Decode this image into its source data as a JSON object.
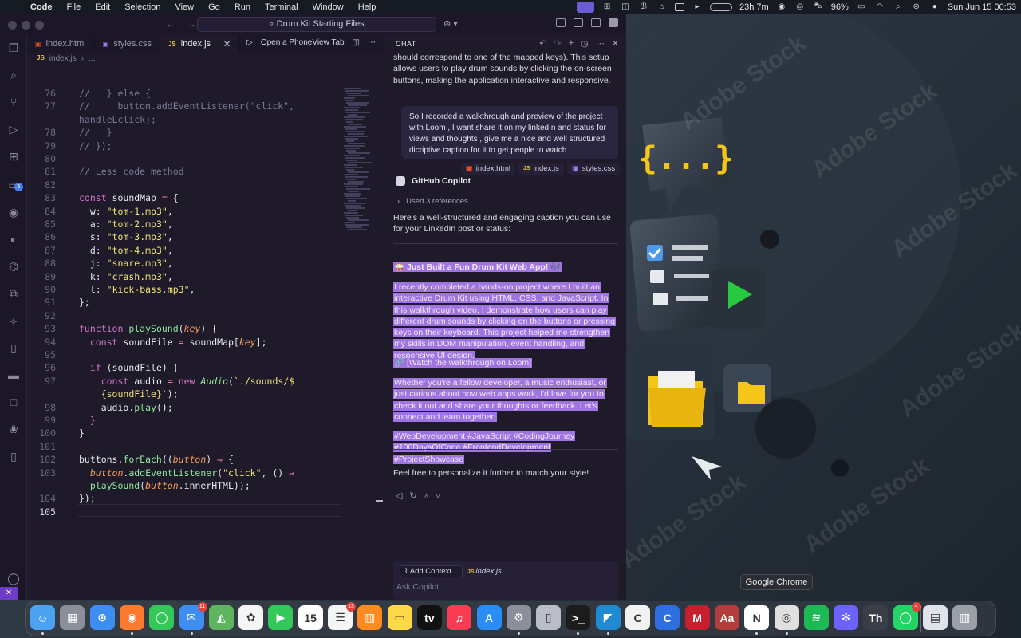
{
  "menubar": {
    "app_name": "Code",
    "items": [
      "File",
      "Edit",
      "Selection",
      "View",
      "Go",
      "Run",
      "Terminal",
      "Window",
      "Help"
    ],
    "timer": "23h 7m",
    "battery": "96%",
    "datetime": "Sun Jun 15  00:53"
  },
  "titlebar": {
    "command_center": "Drum Kit Starting Files"
  },
  "activity_badge": "6",
  "editor": {
    "tabs": [
      {
        "label": "index.html",
        "icon": "html-file-icon"
      },
      {
        "label": "styles.css",
        "icon": "css-file-icon"
      },
      {
        "label": "index.js",
        "icon": "js-file-icon"
      }
    ],
    "tab_action": "Open a PhoneView Tab",
    "breadcrumb": {
      "file": "index.js",
      "rest": "..."
    },
    "current_line": "105"
  },
  "code_lines": [
    {
      "n": "76",
      "html": "<span class=\"tok-com\">//   } else {</span>"
    },
    {
      "n": "77",
      "html": "<span class=\"tok-com\">//     button.addEventListener(\"click\",</span>"
    },
    {
      "n": "",
      "html": "<span class=\"tok-com\">handleLclick);</span>"
    },
    {
      "n": "78",
      "html": "<span class=\"tok-com\">//   }</span>"
    },
    {
      "n": "79",
      "html": "<span class=\"tok-com\">// });</span>"
    },
    {
      "n": "80",
      "html": ""
    },
    {
      "n": "81",
      "html": "<span class=\"tok-com\">// Less code method</span>"
    },
    {
      "n": "82",
      "html": ""
    },
    {
      "n": "83",
      "html": "<span class=\"tok-kw\">const</span> <span class=\"tok-var\">soundMap</span> <span class=\"tok-op\">=</span> <span class=\"tok-var\">{</span>"
    },
    {
      "n": "84",
      "html": "  <span class=\"tok-var\">w:</span> <span class=\"tok-str\">\"tom-1.mp3\"</span><span class=\"tok-var\">,</span>"
    },
    {
      "n": "85",
      "html": "  <span class=\"tok-var\">a:</span> <span class=\"tok-str\">\"tom-2.mp3\"</span><span class=\"tok-var\">,</span>"
    },
    {
      "n": "86",
      "html": "  <span class=\"tok-var\">s:</span> <span class=\"tok-str\">\"tom-3.mp3\"</span><span class=\"tok-var\">,</span>"
    },
    {
      "n": "87",
      "html": "  <span class=\"tok-var\">d:</span> <span class=\"tok-str\">\"tom-4.mp3\"</span><span class=\"tok-var\">,</span>"
    },
    {
      "n": "88",
      "html": "  <span class=\"tok-var\">j:</span> <span class=\"tok-str\">\"snare.mp3\"</span><span class=\"tok-var\">,</span>"
    },
    {
      "n": "89",
      "html": "  <span class=\"tok-var\">k:</span> <span class=\"tok-str\">\"crash.mp3\"</span><span class=\"tok-var\">,</span>"
    },
    {
      "n": "90",
      "html": "  <span class=\"tok-var\">l:</span> <span class=\"tok-str\">\"kick-bass.mp3\"</span><span class=\"tok-var\">,</span>"
    },
    {
      "n": "91",
      "html": "<span class=\"tok-var\">};</span>"
    },
    {
      "n": "92",
      "html": ""
    },
    {
      "n": "93",
      "html": "<span class=\"tok-kw\">function</span> <span class=\"tok-fn\">playSound</span><span class=\"tok-var\">(</span><span class=\"tok-param\">key</span><span class=\"tok-var\">) {</span>"
    },
    {
      "n": "94",
      "html": "  <span class=\"tok-kw\">const</span> <span class=\"tok-var\">soundFile</span> <span class=\"tok-op\">=</span> <span class=\"tok-var\">soundMap[</span><span class=\"tok-param\">key</span><span class=\"tok-var\">];</span>"
    },
    {
      "n": "95",
      "html": ""
    },
    {
      "n": "96",
      "html": "  <span class=\"tok-kw\">if</span> <span class=\"tok-var\">(soundFile) {</span>"
    },
    {
      "n": "97",
      "html": "    <span class=\"tok-kw\">const</span> <span class=\"tok-var\">audio</span> <span class=\"tok-op\">=</span> <span class=\"tok-kw\">new</span> <span class=\"tok-cls\">Audio</span><span class=\"tok-var\">(</span><span class=\"tok-str\">`./sounds/$</span>"
    },
    {
      "n": "",
      "html": "    <span class=\"tok-str\">{soundFile}`</span><span class=\"tok-var\">);</span>"
    },
    {
      "n": "98",
      "html": "    <span class=\"tok-var\">audio.</span><span class=\"tok-fn\">play</span><span class=\"tok-var\">();</span>"
    },
    {
      "n": "99",
      "html": "  <span class=\"tok-kw\">}</span>"
    },
    {
      "n": "100",
      "html": "<span class=\"tok-var\">}</span>"
    },
    {
      "n": "101",
      "html": ""
    },
    {
      "n": "102",
      "html": "<span class=\"tok-var\">buttons.</span><span class=\"tok-fn\">forEach</span><span class=\"tok-var\">((</span><span class=\"tok-param\">button</span><span class=\"tok-var\">)</span> <span class=\"tok-op\">⇒</span> <span class=\"tok-var\">{</span>"
    },
    {
      "n": "103",
      "html": "  <span class=\"tok-param\">button</span><span class=\"tok-var\">.</span><span class=\"tok-fn\">addEventListener</span><span class=\"tok-var\">(</span><span class=\"tok-str\">\"click\"</span><span class=\"tok-var\">, ()</span> <span class=\"tok-op\">⇒</span>"
    },
    {
      "n": "",
      "html": "  <span class=\"tok-fn\">playSound</span><span class=\"tok-var\">(</span><span class=\"tok-param\">button</span><span class=\"tok-var\">.innerHTML));</span>"
    },
    {
      "n": "104",
      "html": "<span class=\"tok-var\">});</span>"
    },
    {
      "n": "105",
      "html": ""
    }
  ],
  "chat": {
    "title": "CHAT",
    "intro_text": "should correspond to one of the mapped keys). This setup allows users to play drum sounds by clicking the on-screen buttons, making the application interactive and responsive.",
    "user_message": "So I recorded a walkthrough and preview of the project with Loom , I want share it on my linkedIn and status for views and thoughts , give me a nice and well structured dicriptive caption for it to get people to watch",
    "references": [
      "index.html",
      "index.js",
      "styles.css"
    ],
    "assistant_name": "GitHub Copilot",
    "used_references": "Used 3 references",
    "reply_intro": "Here's a well-structured and engaging caption you can use for your LinkedIn post or status:",
    "caption_title": "🥁 Just Built a Fun Drum Kit Web App! 🎶",
    "caption_body": "I recently completed a hands-on project where I built an interactive Drum Kit using HTML, CSS, and JavaScript. In this walkthrough video, I demonstrate how users can play different drum sounds by clicking on the buttons or pressing keys on their keyboard. This project helped me strengthen my skills in DOM manipulation, event handling, and responsive UI design.",
    "caption_link": "🔗 [Watch the walkthrough on Loom]",
    "caption_cta": "Whether you're a fellow developer, a music enthusiast, or just curious about how web apps work, I'd love for you to check it out and share your thoughts or feedback. Let's connect and learn together!",
    "hashtags_1": "#WebDevelopment #JavaScript #CodingJourney",
    "hashtags_2": "#100DaysOfCode #FrontendDevelopment #ProjectShowcase",
    "reply_outro": "Feel free to personalize it further to match your style!",
    "add_context": "Add Context...",
    "context_file": "index.js",
    "input_placeholder": "Ask Copilot"
  },
  "desktop": {
    "watermark": "Adobe Stock"
  },
  "dock": {
    "tooltip": "Google Chrome",
    "apps": [
      {
        "name": "Finder",
        "icon": "finder-icon",
        "color": "#4aa2f0",
        "glyph": "☺",
        "dot": true
      },
      {
        "name": "Launchpad",
        "icon": "launchpad-icon",
        "color": "#8b8f99",
        "glyph": "▦",
        "dot": false
      },
      {
        "name": "Safari",
        "icon": "safari-icon",
        "color": "#3d8ef0",
        "glyph": "⊙",
        "dot": false
      },
      {
        "name": "Firefox",
        "icon": "firefox-icon",
        "color": "#ff7a2e",
        "glyph": "◉",
        "dot": true
      },
      {
        "name": "Messages",
        "icon": "messages-icon",
        "color": "#34c759",
        "glyph": "◯",
        "dot": false
      },
      {
        "name": "Mail",
        "icon": "mail-icon",
        "color": "#3d8ef0",
        "glyph": "✉",
        "dot": true,
        "badge": "11"
      },
      {
        "name": "Maps",
        "icon": "maps-icon",
        "color": "#5fb55f",
        "glyph": "◭",
        "dot": false
      },
      {
        "name": "Photos",
        "icon": "photos-icon",
        "color": "#f5f5f5",
        "glyph": "✿",
        "dot": false
      },
      {
        "name": "FaceTime",
        "icon": "facetime-icon",
        "color": "#34c759",
        "glyph": "▶",
        "dot": false
      },
      {
        "name": "Calendar",
        "icon": "calendar-icon",
        "color": "#ffffff",
        "glyph": "15",
        "dot": false
      },
      {
        "name": "Reminders",
        "icon": "reminders-icon",
        "color": "#f5f5f5",
        "glyph": "☰",
        "dot": false,
        "badge": "13"
      },
      {
        "name": "Books",
        "icon": "books-icon",
        "color": "#ff8a1f",
        "glyph": "▥",
        "dot": false
      },
      {
        "name": "Notes",
        "icon": "notes-icon",
        "color": "#ffd84a",
        "glyph": "▭",
        "dot": false
      },
      {
        "name": "Apple TV",
        "icon": "tv-icon",
        "color": "#111111",
        "glyph": "tv",
        "dot": false
      },
      {
        "name": "Music",
        "icon": "music-icon",
        "color": "#fa3c52",
        "glyph": "♫",
        "dot": false
      },
      {
        "name": "App Store",
        "icon": "appstore-icon",
        "color": "#2b8cf5",
        "glyph": "A",
        "dot": false
      },
      {
        "name": "System Settings",
        "icon": "settings-icon",
        "color": "#8b8f99",
        "glyph": "⚙",
        "dot": true
      },
      {
        "name": "iPhone Mirroring",
        "icon": "phone-icon",
        "color": "#b9bec9",
        "glyph": "▯",
        "dot": false
      },
      {
        "name": "Terminal",
        "icon": "terminal-icon",
        "color": "#1c1c1c",
        "glyph": ">_",
        "dot": true
      },
      {
        "name": "VS Code",
        "icon": "vscode-icon",
        "color": "#1f8ad2",
        "glyph": "◤",
        "dot": true
      },
      {
        "name": "Clipboard",
        "icon": "clipboard-icon",
        "color": "#f2f2f2",
        "glyph": "C",
        "dot": false
      },
      {
        "name": "CCleaner",
        "icon": "ccleaner-icon",
        "color": "#2d6fe0",
        "glyph": "C",
        "dot": false
      },
      {
        "name": "Mendeley",
        "icon": "mendeley-icon",
        "color": "#c6202e",
        "glyph": "M",
        "dot": false
      },
      {
        "name": "Dictionary",
        "icon": "dictionary-icon",
        "color": "#b33c3c",
        "glyph": "Aa",
        "dot": false
      },
      {
        "name": "Notion",
        "icon": "notion-icon",
        "color": "#ffffff",
        "glyph": "N",
        "dot": true
      },
      {
        "name": "Google Chrome",
        "icon": "chrome-icon",
        "color": "#e0e0e0",
        "glyph": "◎",
        "dot": true
      },
      {
        "name": "Spotify",
        "icon": "spotify-icon",
        "color": "#1db954",
        "glyph": "≋",
        "dot": false
      },
      {
        "name": "Perplexity",
        "icon": "perplexity-icon",
        "color": "#6c63ff",
        "glyph": "✻",
        "dot": false
      },
      {
        "name": "Thesaurus",
        "icon": "thesaurus-icon",
        "color": "#3a3f47",
        "glyph": "Th",
        "dot": false
      },
      {
        "name": "WhatsApp",
        "icon": "whatsapp-icon",
        "color": "#25d366",
        "glyph": "◯",
        "dot": false,
        "badge": "4"
      },
      {
        "name": "Documents",
        "icon": "documents-folder-icon",
        "color": "#dfe3ea",
        "glyph": "▤",
        "dot": false
      },
      {
        "name": "Trash",
        "icon": "trash-icon",
        "color": "#9aa0a8",
        "glyph": "▥",
        "dot": false
      }
    ]
  }
}
